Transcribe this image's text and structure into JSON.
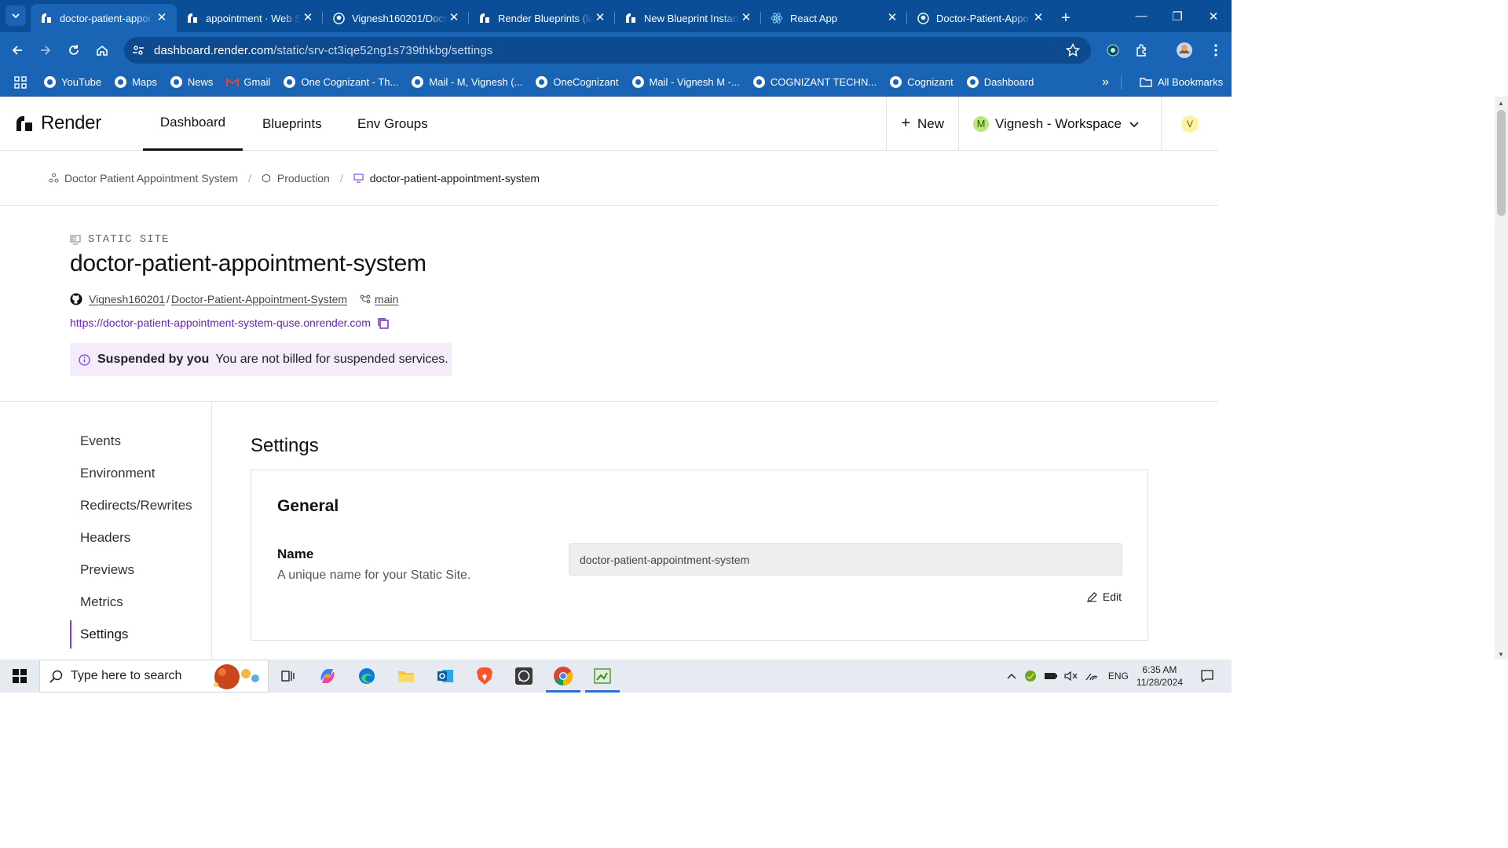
{
  "browser": {
    "tabs": [
      {
        "title": "doctor-patient-appoi",
        "icon": "render-logo-icon",
        "active": true
      },
      {
        "title": "appointment · Web S",
        "icon": "render-logo-icon"
      },
      {
        "title": "Vignesh160201/Doct",
        "icon": "github-icon"
      },
      {
        "title": "Render Blueprints (la",
        "icon": "render-logo-icon"
      },
      {
        "title": "New Blueprint Instan",
        "icon": "render-logo-icon"
      },
      {
        "title": "React App",
        "icon": "react-icon"
      },
      {
        "title": "Doctor-Patient-Appo",
        "icon": "github-icon"
      }
    ],
    "new_tab": "+",
    "url_host": "dashboard.render.com",
    "url_path": "/static/srv-ct3iqe52ng1s739thkbg/settings",
    "bookmarks": [
      "YouTube",
      "Maps",
      "News",
      "Gmail",
      "One Cognizant - Th...",
      "Mail - M, Vignesh (...",
      "OneCognizant",
      "Mail - Vignesh M -...",
      "COGNIZANT TECHN...",
      "Cognizant",
      "Dashboard"
    ],
    "all_bookmarks": "All Bookmarks"
  },
  "topnav": {
    "brand": "Render",
    "links": [
      "Dashboard",
      "Blueprints",
      "Env Groups"
    ],
    "active_link": "Dashboard",
    "new_label": "New",
    "workspace_initial": "M",
    "workspace_label": "Vignesh - Workspace",
    "avatar_initial": "V"
  },
  "breadcrumb": {
    "project": "Doctor Patient Appointment System",
    "environment": "Production",
    "service": "doctor-patient-appointment-system"
  },
  "service": {
    "kind": "STATIC SITE",
    "name": "doctor-patient-appointment-system",
    "repo_owner": "Vignesh160201",
    "repo_sep": "/",
    "repo_name": "Doctor-Patient-Appointment-System",
    "branch": "main",
    "url": "https://doctor-patient-appointment-system-quse.onrender.com"
  },
  "banner": {
    "title": "Suspended by you",
    "message": "You are not billed for suspended services."
  },
  "sidenav": {
    "items": [
      "Events",
      "Environment",
      "Redirects/Rewrites",
      "Headers",
      "Previews",
      "Metrics",
      "Settings"
    ],
    "active": "Settings"
  },
  "settings": {
    "heading": "Settings",
    "general_heading": "General",
    "name_label": "Name",
    "name_desc": "A unique name for your Static Site.",
    "name_value": "doctor-patient-appointment-system",
    "edit_label": "Edit"
  },
  "taskbar": {
    "search_placeholder": "Type here to search",
    "language": "ENG",
    "time": "6:35 AM",
    "date": "11/28/2024"
  },
  "colors": {
    "chrome_dark": "#0b4e98",
    "chrome": "#1a64b6",
    "accent_purple": "#7c3aed",
    "banner_bg": "#f4ecfb",
    "link_purple": "#6b21c8"
  }
}
